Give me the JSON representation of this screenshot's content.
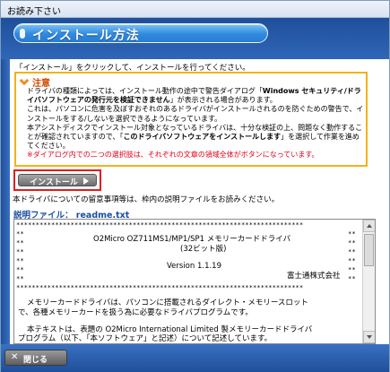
{
  "window": {
    "title": "お読み下さい"
  },
  "header": {
    "title": "インストール方法"
  },
  "intro_text": "「インストール」をクリックして、インストールを行ってください。",
  "note": {
    "title": "注意",
    "icon": "warning-diamond-icon",
    "line1a": "ドライバの種類によっては、インストール動作の途中で警告ダイアログ「",
    "line1b": "Windows セキュリティ/ドライバソフトウェアの発行元を検証できません",
    "line1c": "」が表示される場合があります。",
    "line2": "これは、パソコンに危害を及ぼすおそれのあるドライバがインストールされるのを防ぐための警告で、インストールをする/しないを選択できるようになっています。",
    "line3a": "本アシストディスクでインストール対象となっているドライバは、十分な検証の上、問題なく動作することが確認されていますので、「",
    "line3b": "このドライバソフトウェアをインストールします",
    "line3c": "」を選択して作業を進めてください。",
    "red_text": "※ダイアログ内での二つの選択肢は、それぞれの文章の領域全体がボタンになっています。"
  },
  "install_button": {
    "label": "インストール"
  },
  "after_text": "本ドライバについての留意事項等は、枠内の説明ファイルをお読みください。",
  "file": {
    "label": "説明ファイル： readme.txt"
  },
  "readme": {
    "stars": "**************************************************************************",
    "side": "**",
    "title": "O2Micro OZ711MS1/MP1/SP1 メモリーカードドライバ",
    "subtitle": "(32ビット版)",
    "version": "Version 1.1.19",
    "company": "富士通株式会社",
    "para1_l1": "メモリーカードドライバは、パソコンに搭載されるダイレクト・メモリースロット",
    "para1_l2": "で、各種メモリーカードを扱う為に必要なドライバプログラムです。",
    "para2_l1": "本テキストは、表題の O2Micro International Limited 製メモリーカードドライバ",
    "para2_l2": "プログラム（以下、「本ソフトウェア」と記述）について記述しています。"
  },
  "close_button": {
    "label": "閉じる",
    "icon": "close-x-icon"
  }
}
